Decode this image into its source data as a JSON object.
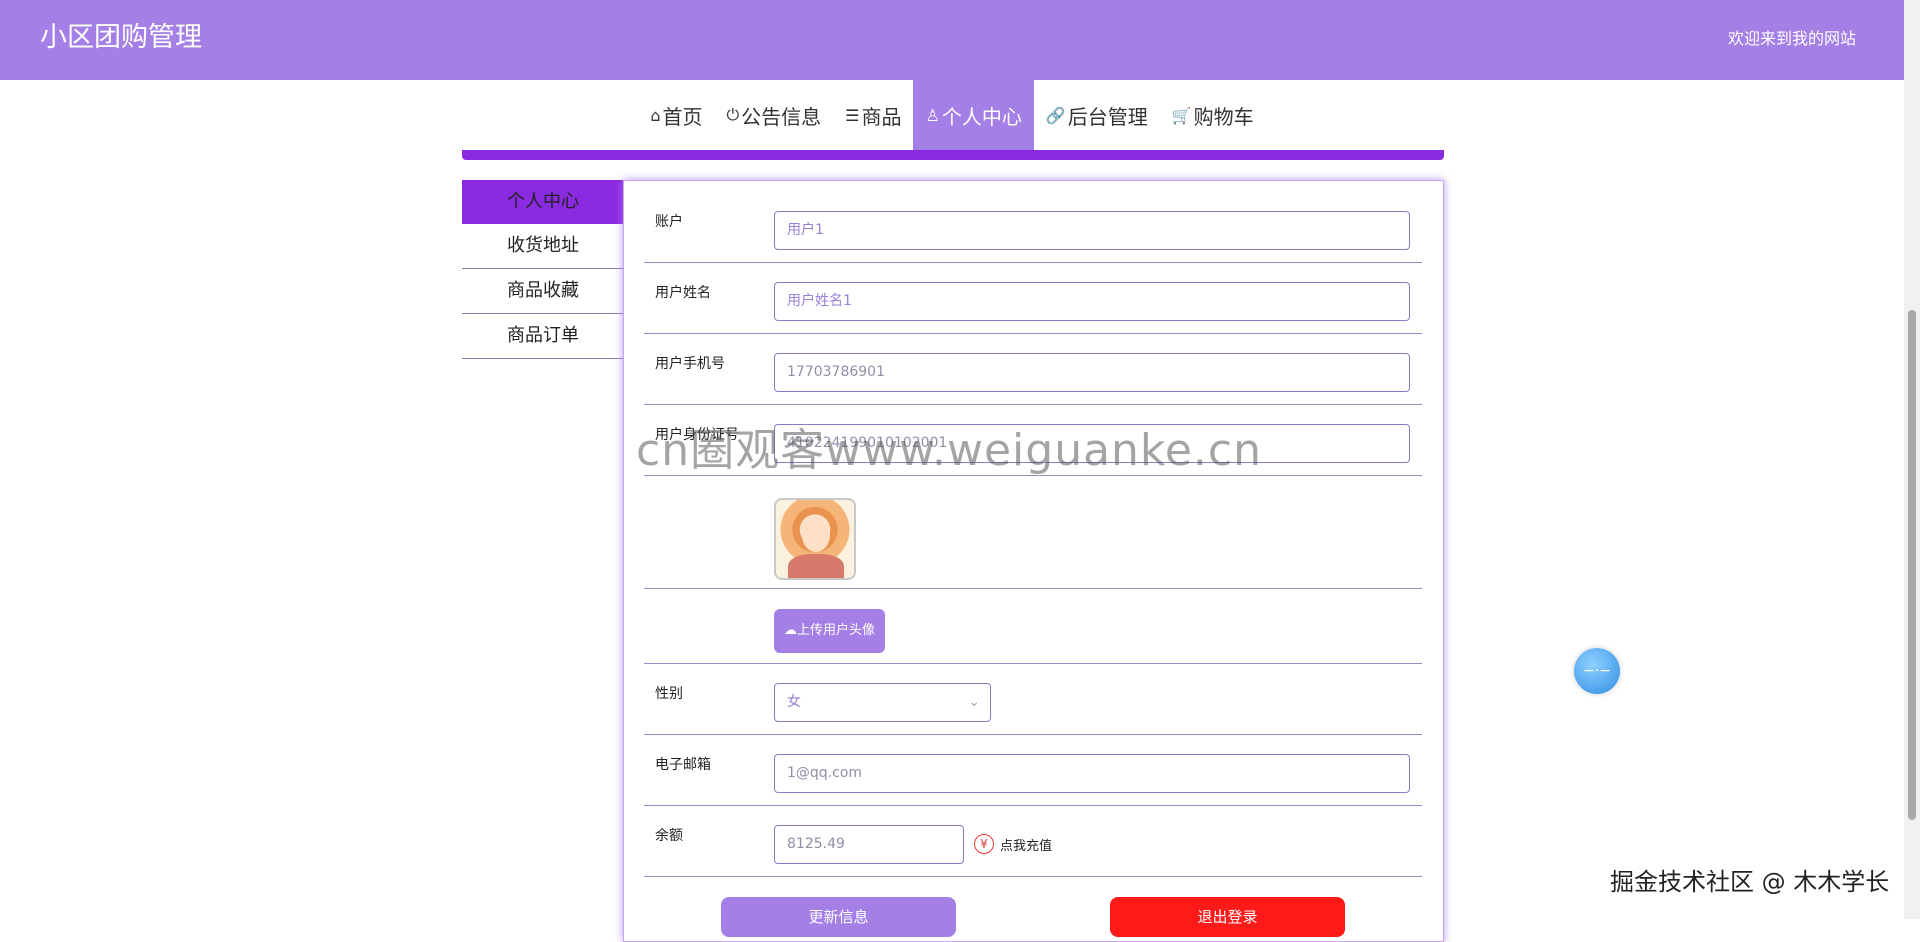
{
  "header": {
    "site_title": "小区团购管理",
    "welcome": "欢迎来到我的网站"
  },
  "nav": [
    {
      "icon": "home-icon",
      "glyph": "⌂",
      "label": "首页"
    },
    {
      "icon": "power-icon",
      "glyph": "⏻",
      "label": "公告信息"
    },
    {
      "icon": "sliders-icon",
      "glyph": "☰",
      "label": "商品"
    },
    {
      "icon": "user-icon",
      "glyph": "♙",
      "label": "个人中心",
      "active": true
    },
    {
      "icon": "link-icon",
      "glyph": "🔗",
      "label": "后台管理"
    },
    {
      "icon": "cart-icon",
      "glyph": "🛒",
      "label": "购物车"
    }
  ],
  "sidebar": [
    {
      "label": "个人中心",
      "active": true
    },
    {
      "label": "收货地址"
    },
    {
      "label": "商品收藏"
    },
    {
      "label": "商品订单"
    }
  ],
  "form": {
    "account": {
      "label": "账户",
      "value": "用户1"
    },
    "name": {
      "label": "用户姓名",
      "value": "用户姓名1"
    },
    "phone": {
      "label": "用户手机号",
      "value": "17703786901"
    },
    "idcard": {
      "label": "用户身份证号",
      "value": "410224199010102001"
    },
    "upload_label": "上传用户头像",
    "gender": {
      "label": "性别",
      "value": "女"
    },
    "email": {
      "label": "电子邮箱",
      "value": "1@qq.com"
    },
    "balance": {
      "label": "余额",
      "value": "8125.49",
      "recharge": "点我充值"
    }
  },
  "buttons": {
    "update": "更新信息",
    "logout": "退出登录"
  },
  "watermark": "cn圈观客www.weiguanke.cn",
  "credit": "掘金技术社区 @ 木木学长",
  "colors": {
    "accent": "#a47fe6",
    "active_nav": "#8a2be2",
    "logout": "#ff1a1a"
  }
}
